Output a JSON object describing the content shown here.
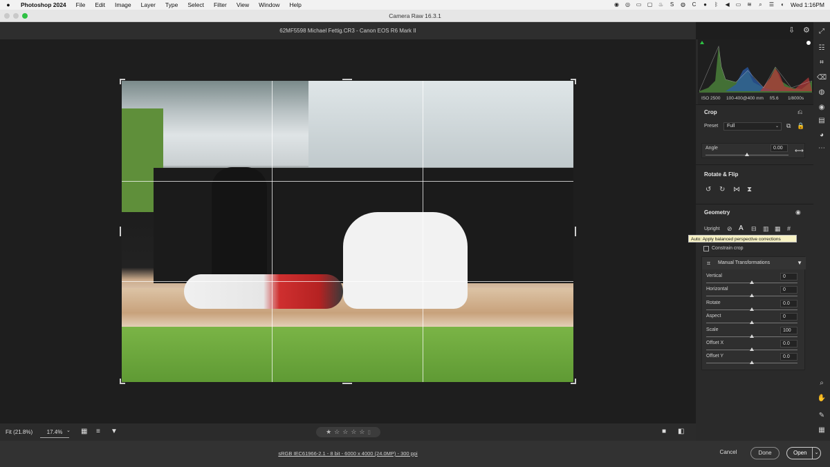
{
  "menubar": {
    "apple": "",
    "app_name": "Photoshop 2024",
    "items": [
      "File",
      "Edit",
      "Image",
      "Layer",
      "Type",
      "Select",
      "Filter",
      "View",
      "Window",
      "Help"
    ],
    "clock": "Wed 1:16PM"
  },
  "window": {
    "title": "Camera Raw 16.3.1",
    "file_label": "62MF5598 Michael Fettig.CR3  -  Canon EOS R6 Mark II"
  },
  "histogram": {
    "iso": "ISO 2500",
    "lens": "100-400@400 mm",
    "aperture": "f/5.6",
    "shutter": "1/8000s"
  },
  "crop": {
    "title": "Crop",
    "preset_label": "Preset",
    "preset_value": "Full",
    "angle_label": "Angle",
    "angle_value": "0.00"
  },
  "rotate_flip": {
    "title": "Rotate & Flip"
  },
  "geometry": {
    "title": "Geometry",
    "upright_label": "Upright",
    "tooltip": "Auto: Apply balanced perspective corrections",
    "constrain_label": "Constrain crop",
    "manual_title": "Manual Transformations",
    "sliders": [
      {
        "label": "Vertical",
        "value": "0"
      },
      {
        "label": "Horizontal",
        "value": "0"
      },
      {
        "label": "Rotate",
        "value": "0.0"
      },
      {
        "label": "Aspect",
        "value": "0"
      },
      {
        "label": "Scale",
        "value": "100"
      },
      {
        "label": "Offset X",
        "value": "0.0"
      },
      {
        "label": "Offset Y",
        "value": "0.0"
      }
    ]
  },
  "bottombar": {
    "fit": "Fit (21.8%)",
    "zoom": "17.4%",
    "rating_stars": 0
  },
  "footer": {
    "info": "sRGB IEC61966-2.1 - 8 bit - 6000 x 4000 (24.0MP) - 300 ppi",
    "cancel": "Cancel",
    "done": "Done",
    "open": "Open"
  },
  "colors": {
    "accent_green": "#2fc144",
    "tooltip_bg": "#f7f2c4"
  }
}
